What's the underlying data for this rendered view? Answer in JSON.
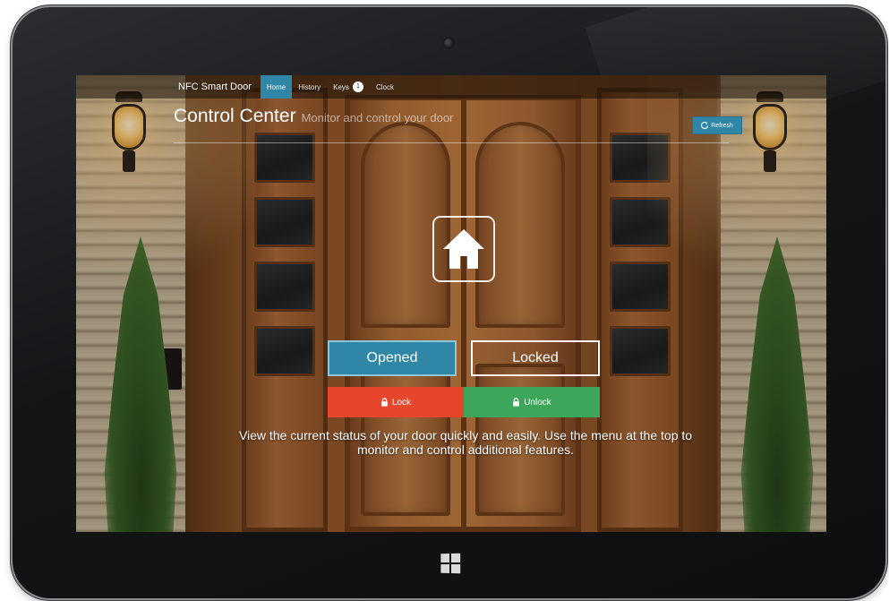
{
  "navbar": {
    "brand": "NFC Smart Door",
    "items": [
      {
        "label": "Home",
        "active": true
      },
      {
        "label": "History",
        "active": false
      },
      {
        "label": "Keys",
        "active": false,
        "badge": "1"
      },
      {
        "label": "Clock",
        "active": false
      }
    ]
  },
  "header": {
    "title": "Control Center",
    "subtitle": "Monitor and control your door",
    "refresh_label": "Refresh",
    "refresh_icon": "refresh-icon"
  },
  "status": {
    "icon": "home-icon",
    "opened_label": "Opened",
    "locked_label": "Locked"
  },
  "actions": {
    "lock_label": "Lock",
    "unlock_label": "Unlock",
    "lock_icon": "lock-icon",
    "unlock_icon": "unlock-icon"
  },
  "description": "View the current status of your door quickly and easily. Use the menu at the top to monitor and control additional features.",
  "colors": {
    "primary": "#2f86a6",
    "danger": "#e5462c",
    "success": "#3ea65a"
  }
}
